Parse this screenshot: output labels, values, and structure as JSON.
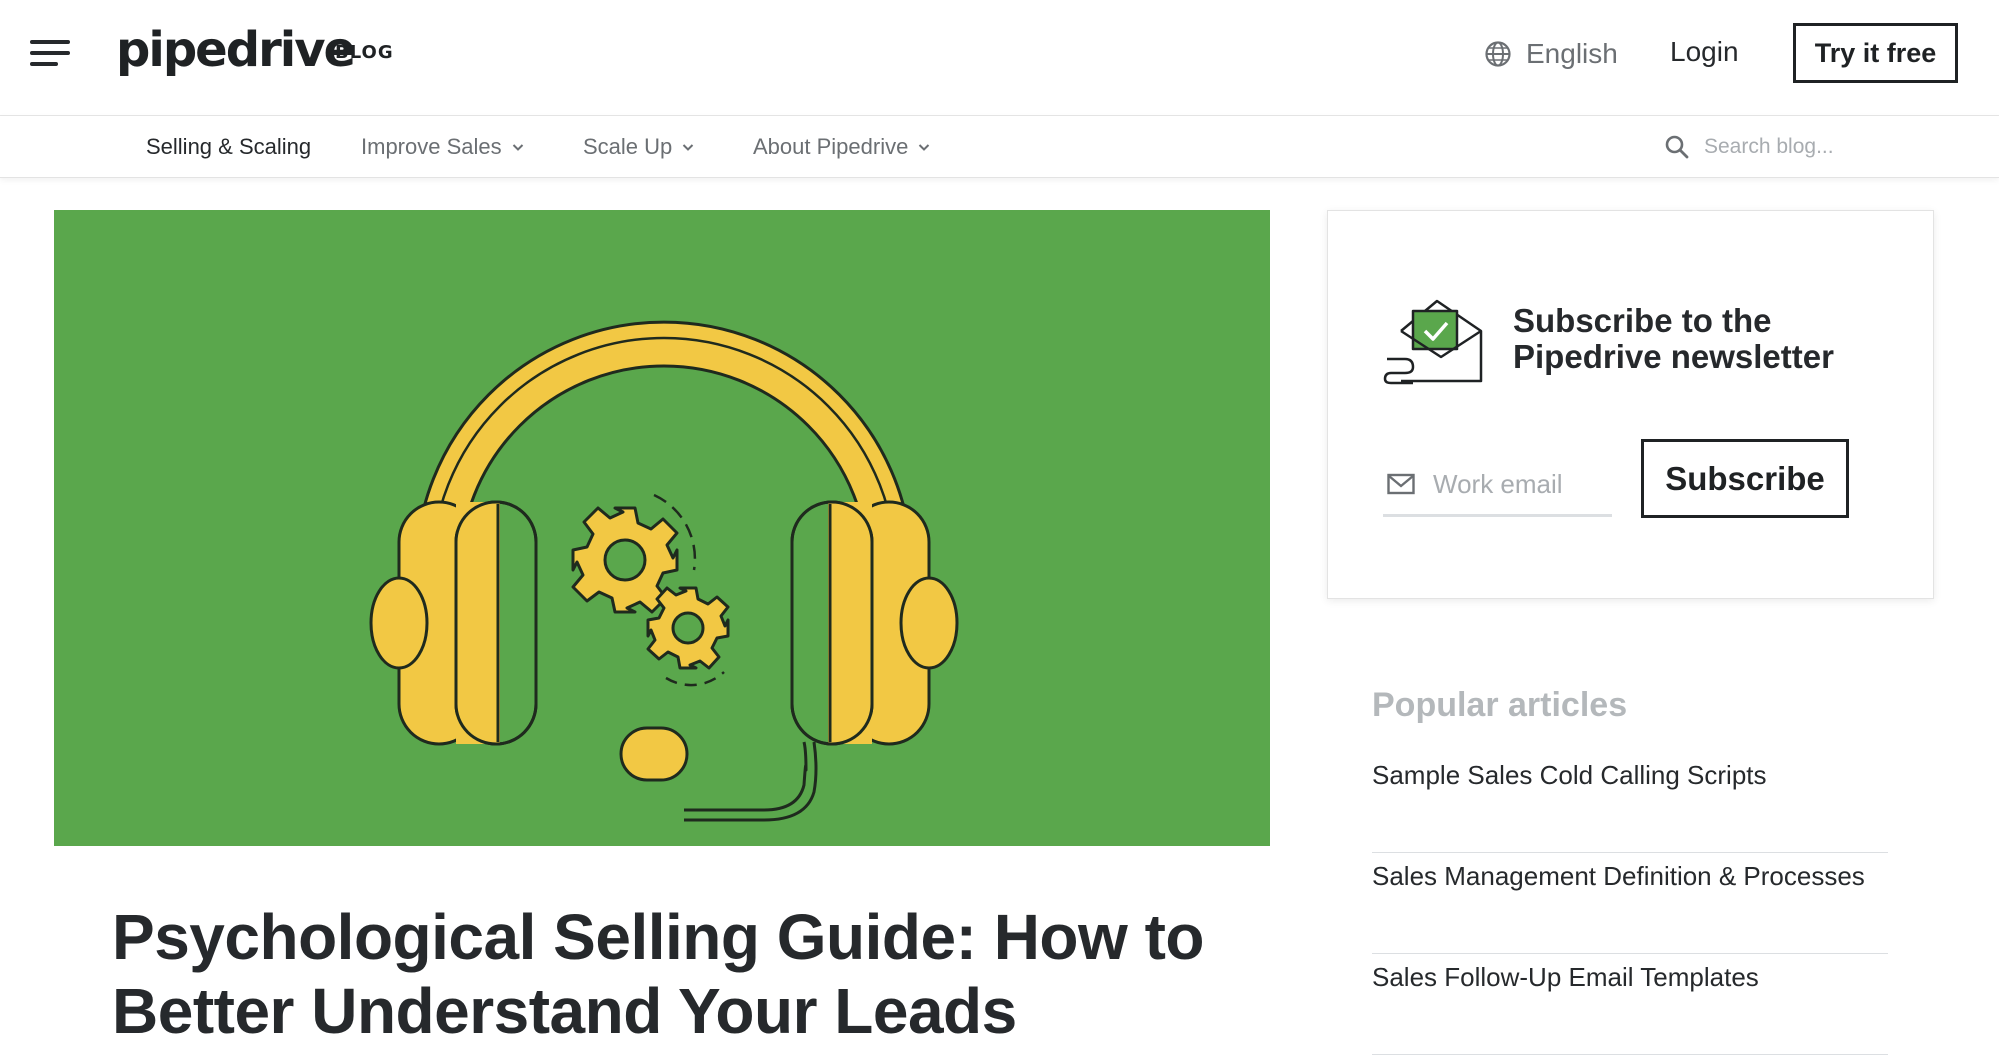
{
  "header": {
    "logo_text": "pipedrive",
    "logo_suffix": "BLOG",
    "language": "English",
    "login_label": "Login",
    "cta_label": "Try it free",
    "icons": [
      "menu-icon",
      "globe-icon"
    ]
  },
  "subnav": {
    "items": [
      {
        "label": "Selling & Scaling",
        "has_dropdown": false,
        "active": true
      },
      {
        "label": "Improve Sales",
        "has_dropdown": true
      },
      {
        "label": "Scale Up",
        "has_dropdown": true
      },
      {
        "label": "About Pipedrive",
        "has_dropdown": true
      }
    ],
    "search_placeholder": "Search blog..."
  },
  "hero": {
    "illustration": "headset-with-gears",
    "background_color": "#5aa74c",
    "accent_color": "#f2c844"
  },
  "article": {
    "title": "Psychological Selling Guide: How to Better Understand Your Leads"
  },
  "newsletter": {
    "title": "Subscribe to the Pipedrive newsletter",
    "email_placeholder": "Work email",
    "button_label": "Subscribe",
    "icon": "envelope-check-icon"
  },
  "popular": {
    "heading": "Popular articles",
    "items": [
      "Sample Sales Cold Calling Scripts",
      "Sales Management Definition & Processes",
      "Sales Follow-Up Email Templates"
    ]
  }
}
